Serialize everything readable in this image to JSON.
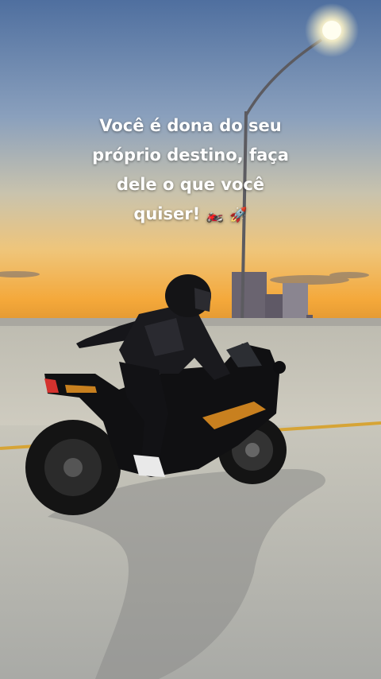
{
  "caption": {
    "line1": "Você é dona do seu",
    "line2": "próprio destino, faça",
    "line3": "dele o que você",
    "line4_text": "quiser!",
    "emoji_1": "🏍️",
    "emoji_2": "🚀"
  },
  "scene": {
    "elements": [
      "sunset-sky",
      "street-lamp",
      "city-buildings",
      "overpass-wall",
      "road",
      "rider",
      "motorcycle",
      "shadow"
    ],
    "colors": {
      "sky_top": "#5f7fae",
      "sky_mid": "#a9b6c6",
      "horizon_glow": "#f5b13b",
      "road": "#bcbcb3",
      "bike_accent": "#c8801f"
    }
  }
}
